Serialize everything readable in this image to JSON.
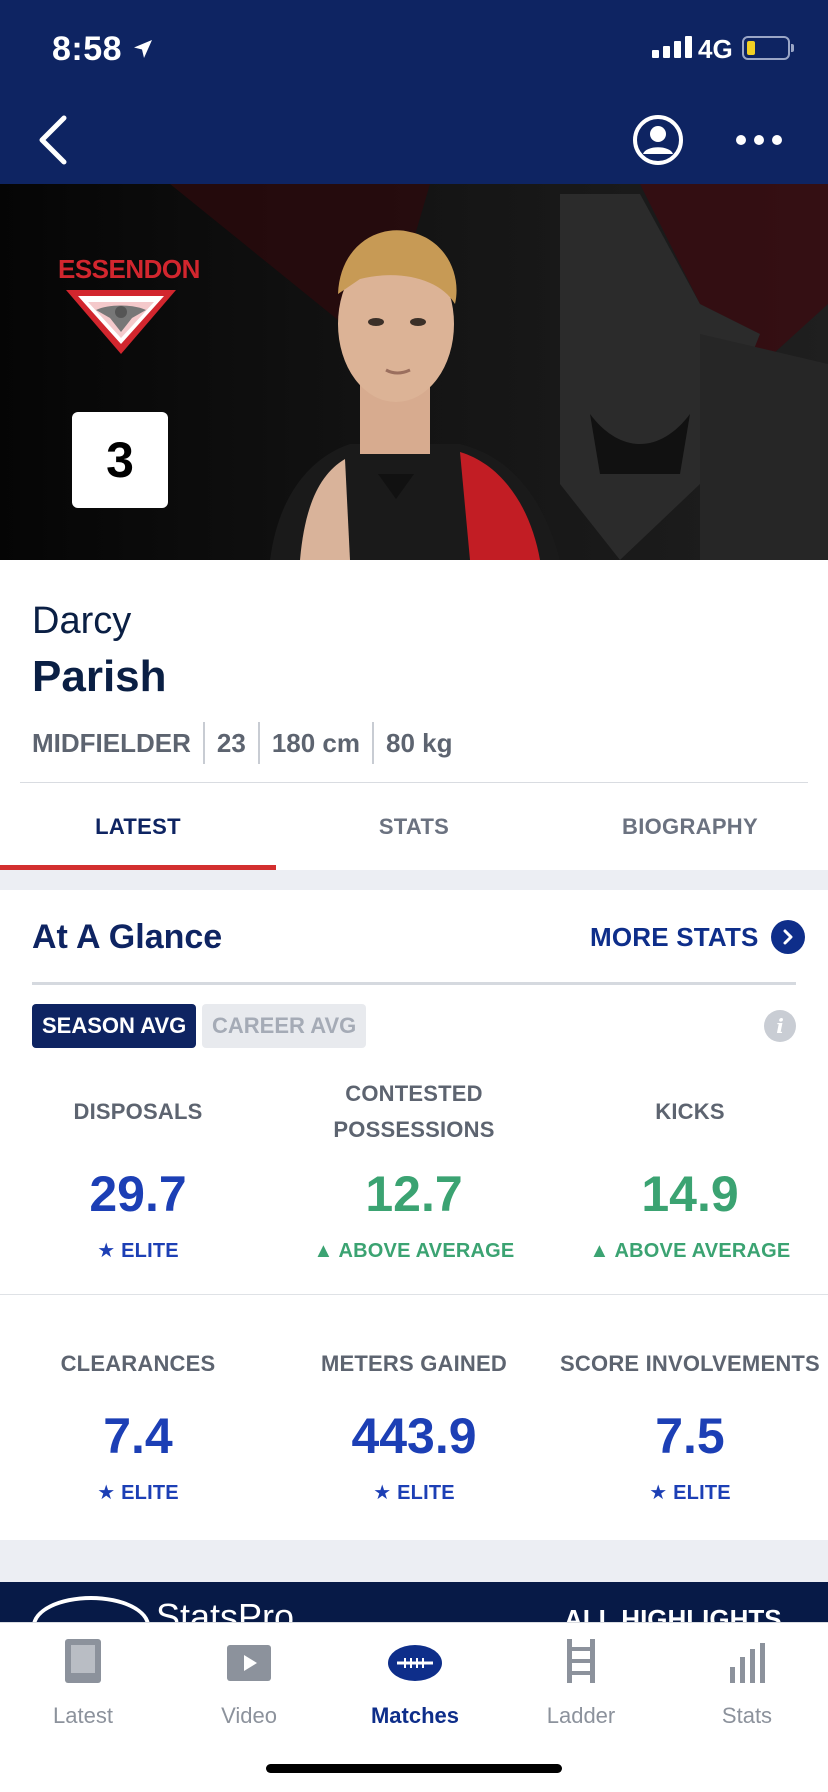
{
  "status_bar": {
    "time": "8:58",
    "network": "4G"
  },
  "hero": {
    "club_name": "ESSENDON",
    "jersey_number": "3"
  },
  "player": {
    "first_name": "Darcy",
    "last_name": "Parish",
    "position": "MIDFIELDER",
    "age": "23",
    "height": "180 cm",
    "weight": "80 kg"
  },
  "tabs": [
    {
      "label": "LATEST",
      "active": true
    },
    {
      "label": "STATS",
      "active": false
    },
    {
      "label": "BIOGRAPHY",
      "active": false
    }
  ],
  "glance": {
    "title": "At A Glance",
    "more_stats": "MORE STATS",
    "toggles": {
      "season": "SEASON AVG",
      "career": "CAREER AVG",
      "selected": "season"
    },
    "stats": [
      {
        "label": "DISPOSALS",
        "value": "29.7",
        "rating": "ELITE",
        "rating_type": "elite"
      },
      {
        "label": "CONTESTED POSSESSIONS",
        "value": "12.7",
        "rating": "ABOVE AVERAGE",
        "rating_type": "above"
      },
      {
        "label": "KICKS",
        "value": "14.9",
        "rating": "ABOVE AVERAGE",
        "rating_type": "above"
      },
      {
        "label": "CLEARANCES",
        "value": "7.4",
        "rating": "ELITE",
        "rating_type": "elite"
      },
      {
        "label": "METERS GAINED",
        "value": "443.9",
        "rating": "ELITE",
        "rating_type": "elite"
      },
      {
        "label": "SCORE INVOLVEMENTS",
        "value": "7.5",
        "rating": "ELITE",
        "rating_type": "elite"
      }
    ]
  },
  "promo": {
    "brand": "StatsPro",
    "link": "ALL HIGHLIGHTS"
  },
  "bottom_nav": [
    {
      "label": "Latest",
      "icon": "latest-icon",
      "active": false
    },
    {
      "label": "Video",
      "icon": "video-icon",
      "active": false
    },
    {
      "label": "Matches",
      "icon": "football-icon",
      "active": true
    },
    {
      "label": "Ladder",
      "icon": "ladder-icon",
      "active": false
    },
    {
      "label": "Stats",
      "icon": "bar-chart-icon",
      "active": false
    }
  ],
  "colors": {
    "navy": "#0e2462",
    "accent_red": "#d32f2f",
    "elite_blue": "#1c3fb5",
    "above_green": "#3ba372"
  }
}
